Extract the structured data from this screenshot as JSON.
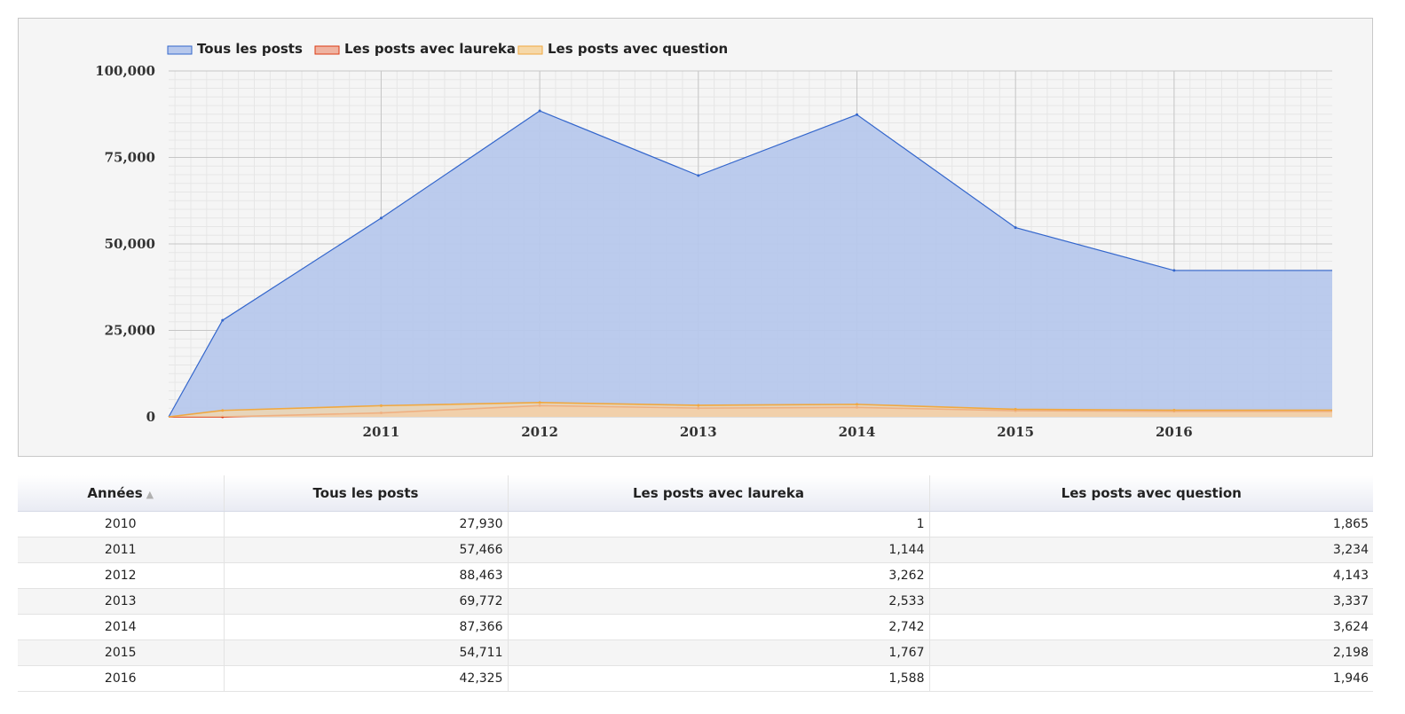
{
  "chart_data": {
    "type": "area",
    "title": "",
    "xlabel": "",
    "ylabel": "",
    "x": [
      2010,
      2011,
      2012,
      2013,
      2014,
      2015,
      2016
    ],
    "x_tick_labels": [
      "2011",
      "2012",
      "2013",
      "2014",
      "2015",
      "2016"
    ],
    "y_tick_labels": [
      "0",
      "25,000",
      "50,000",
      "75,000",
      "100,000"
    ],
    "ylim": [
      0,
      100000
    ],
    "grid": true,
    "legend_position": "top-left",
    "series": [
      {
        "name": "Tous les posts",
        "color": "#3366cc",
        "fill": "#b7c8ec",
        "values": [
          27930,
          57466,
          88463,
          69772,
          87366,
          54711,
          42325
        ]
      },
      {
        "name": "Les posts avec laureka",
        "color": "#dc3912",
        "fill": "#efb3a1",
        "values": [
          1,
          1144,
          3262,
          2533,
          2742,
          1767,
          1588
        ]
      },
      {
        "name": "Les posts avec question",
        "color": "#f0a840",
        "fill": "#f6d8a8",
        "values": [
          1865,
          3234,
          4143,
          3337,
          3624,
          2198,
          1946
        ]
      }
    ]
  },
  "table": {
    "headers": [
      "Années",
      "Tous les posts",
      "Les posts avec laureka",
      "Les posts avec question"
    ],
    "rows": [
      [
        "2010",
        "27,930",
        "1",
        "1,865"
      ],
      [
        "2011",
        "57,466",
        "1,144",
        "3,234"
      ],
      [
        "2012",
        "88,463",
        "3,262",
        "4,143"
      ],
      [
        "2013",
        "69,772",
        "2,533",
        "3,337"
      ],
      [
        "2014",
        "87,366",
        "2,742",
        "3,624"
      ],
      [
        "2015",
        "54,711",
        "1,767",
        "2,198"
      ],
      [
        "2016",
        "42,325",
        "1,588",
        "1,946"
      ]
    ]
  }
}
